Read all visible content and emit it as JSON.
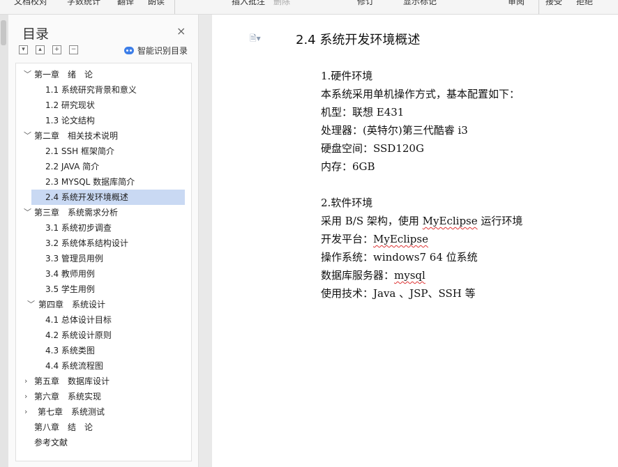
{
  "toolbar": {
    "items": [
      "文档校对",
      "字数统计",
      "翻译",
      "朗读",
      "插入批注",
      "删除",
      "修订",
      "显示标记",
      "审阅",
      "接受",
      "拒绝"
    ]
  },
  "toc_panel": {
    "title": "目录",
    "close": "×",
    "smart_label": "智能识别目录",
    "items": [
      {
        "label": "第一章　绪　论"
      },
      {
        "label": "1.1 系统研究背景和意义"
      },
      {
        "label": "1.2 研究现状"
      },
      {
        "label": "1.3 论文结构"
      },
      {
        "label": "第二章　相关技术说明"
      },
      {
        "label": "2.1 SSH 框架简介"
      },
      {
        "label": "2.2 JAVA 简介"
      },
      {
        "label": "2.3 MYSQL 数据库简介"
      },
      {
        "label": "2.4 系统开发环境概述"
      },
      {
        "label": "第三章　系统需求分析"
      },
      {
        "label": "3.1 系统初步调查"
      },
      {
        "label": "3.2 系统体系结构设计"
      },
      {
        "label": "3.3 管理员用例"
      },
      {
        "label": "3.4 教师用例"
      },
      {
        "label": "3.5 学生用例"
      },
      {
        "label": "第四章　系统设计"
      },
      {
        "label": "4.1 总体设计目标"
      },
      {
        "label": "4.2 系统设计原则"
      },
      {
        "label": "4.3 系统类图"
      },
      {
        "label": "4.4 系统流程图"
      },
      {
        "label": "第五章　数据库设计"
      },
      {
        "label": "第六章　系统实现"
      },
      {
        "label": "第七章　系统测试"
      },
      {
        "label": "第八章　结　论"
      },
      {
        "label": "参考文献"
      }
    ]
  },
  "document": {
    "heading": "2.4 系统开发环境概述",
    "hw_title": "1.硬件环境",
    "hw_intro": "本系统采用单机操作方式，基本配置如下：",
    "model": "机型：联想 E431",
    "cpu": "处理器：(英特尔)第三代酷睿  i3",
    "disk": "硬盘空间：SSD120G",
    "ram": "内存：6GB",
    "sw_title": "2.软件环境",
    "arch_a": "采用 B/S 架构，使用 ",
    "arch_b": "MyEclipse",
    "arch_c": " 运行环境",
    "platform_a": "开发平台：",
    "platform_b": "MyEclipse",
    "os": "操作系统：windows7 64 位系统",
    "db_a": "数据库服务器：",
    "db_b": "mysql",
    "tech": "使用技术：Java 、JSP、SSH 等"
  }
}
